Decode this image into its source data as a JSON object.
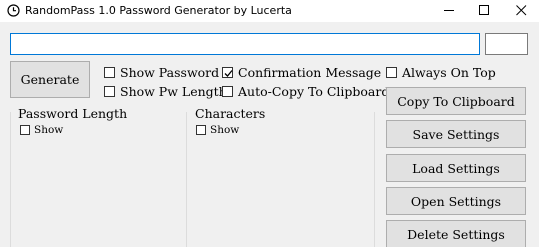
{
  "window": {
    "title": "RandomPass 1.0 Password Generator by Lucerta",
    "icons": {
      "app": "clock-icon",
      "minimize": "minimize-icon",
      "maximize": "maximize-icon",
      "close": "close-icon"
    }
  },
  "password_field": {
    "value": ""
  },
  "length_field": {
    "value": ""
  },
  "buttons": {
    "generate": "Generate",
    "copy": "Copy To Clipboard",
    "save": "Save Settings",
    "load": "Load Settings",
    "open": "Open Settings",
    "delete": "Delete Settings"
  },
  "options": {
    "show_password": {
      "label": "Show Password",
      "checked": false
    },
    "show_pw_length": {
      "label": "Show Pw Length",
      "checked": false
    },
    "confirmation_message": {
      "label": "Confirmation Message",
      "checked": true
    },
    "auto_copy": {
      "label": "Auto-Copy To Clipboard",
      "checked": false
    },
    "always_on_top": {
      "label": "Always On Top",
      "checked": false
    }
  },
  "groups": {
    "password_length": {
      "label": "Password Length",
      "show_label": "Show",
      "show_checked": false
    },
    "characters": {
      "label": "Characters",
      "show_label": "Show",
      "show_checked": false
    }
  },
  "colors": {
    "focus_border": "#0078d7",
    "button_bg": "#e1e1e1",
    "window_bg": "#f0f0f0"
  }
}
